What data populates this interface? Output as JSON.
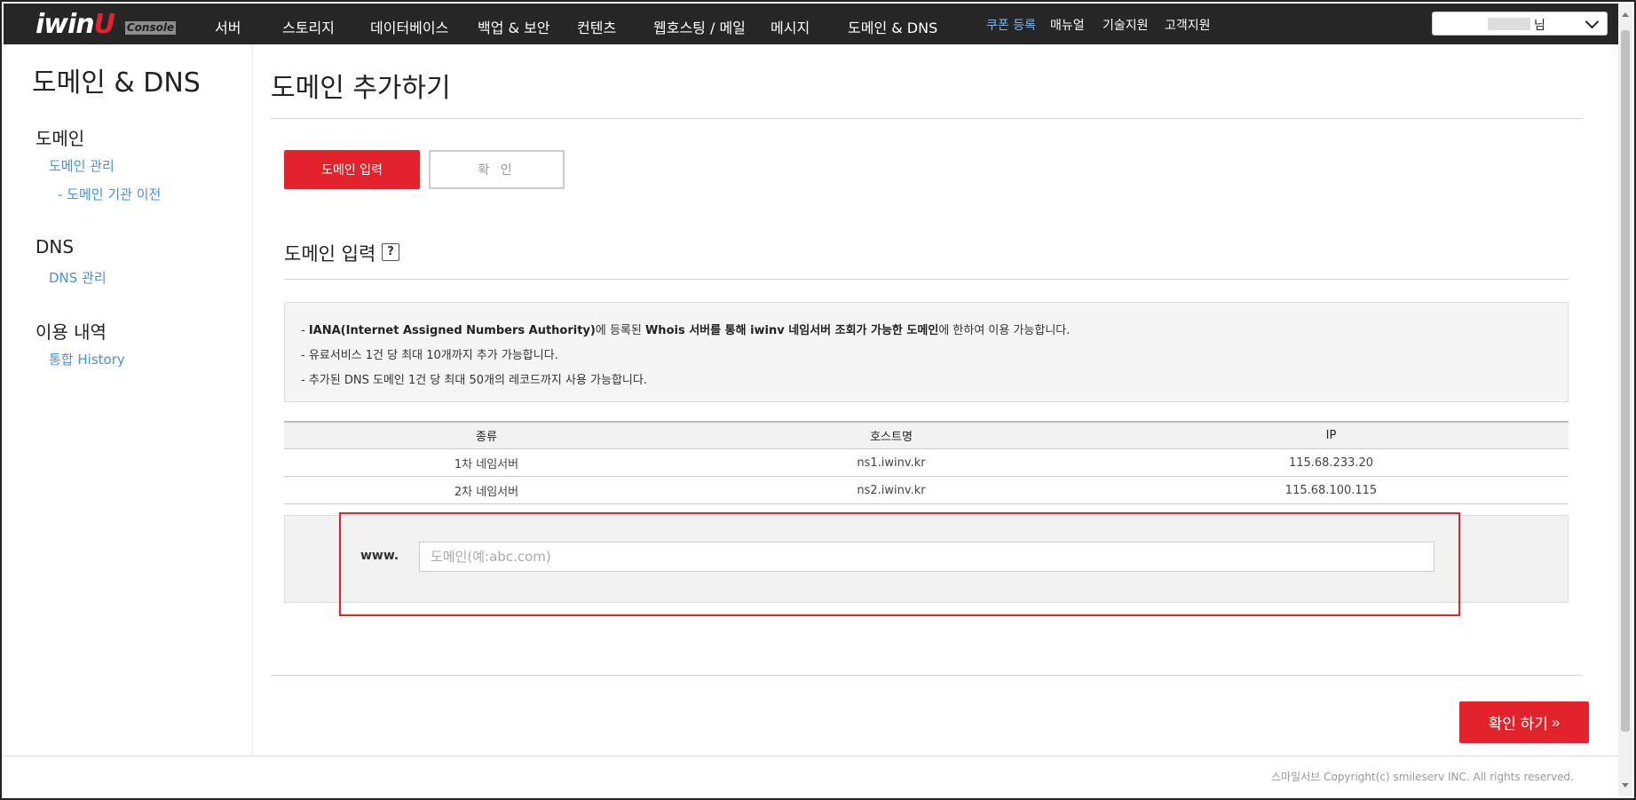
{
  "header": {
    "logo_text": "iwin",
    "logo_smile": "ᑌ",
    "console_badge": "Console",
    "nav": [
      "서버",
      "스토리지",
      "데이터베이스",
      "백업 & 보안",
      "컨텐츠",
      "웹호스팅 / 메일",
      "메시지",
      "도메인 & DNS"
    ],
    "utility": [
      "쿠폰 등록",
      "매뉴얼",
      "기술지원",
      "고객지원"
    ],
    "user_suffix": "님"
  },
  "sidebar": {
    "title": "도메인 & DNS",
    "sections": [
      {
        "label": "도메인",
        "links": [
          "도메인 관리",
          "- 도메인 기관 이전"
        ]
      },
      {
        "label": "DNS",
        "links": [
          "DNS 관리"
        ]
      },
      {
        "label": "이용 내역",
        "links": [
          "통합 History"
        ]
      }
    ]
  },
  "main": {
    "page_title": "도메인 추가하기",
    "steps": [
      "도메인 입력",
      "확 인"
    ],
    "section_title": "도메인 입력",
    "help_icon": "?",
    "notices": [
      {
        "prefix": "- ",
        "bold": "IANA(Internet Assigned Numbers Authority)",
        "mid": "에 등록된 ",
        "bold2": "Whois 서버를 통해 iwinv 네임서버 조회가 가능한 도메인",
        "suffix": "에 한하여 이용 가능합니다."
      },
      {
        "text": "- 유료서비스 1건 당 최대 10개까지 추가 가능합니다."
      },
      {
        "text": "- 추가된 DNS 도메인 1건 당 최대 50개의 레코드까지 사용 가능합니다."
      }
    ],
    "table": {
      "headers": [
        "종류",
        "호스트명",
        "IP"
      ],
      "rows": [
        [
          "1차 네임서버",
          "ns1.iwinv.kr",
          "115.68.233.20"
        ],
        [
          "2차 네임서버",
          "ns2.iwinv.kr",
          "115.68.100.115"
        ]
      ]
    },
    "domain_input": {
      "prefix_label": "www.",
      "placeholder": "도메인(예:abc.com)",
      "value": ""
    },
    "confirm_button": "확인 하기",
    "confirm_arrow": "»"
  },
  "footer": {
    "copyright": "스마일서브 Copyright(c) smileserv INC. All rights reserved."
  },
  "colors": {
    "accent": "#e3232c",
    "nav_bg": "#262626",
    "link": "#4a90d9"
  }
}
